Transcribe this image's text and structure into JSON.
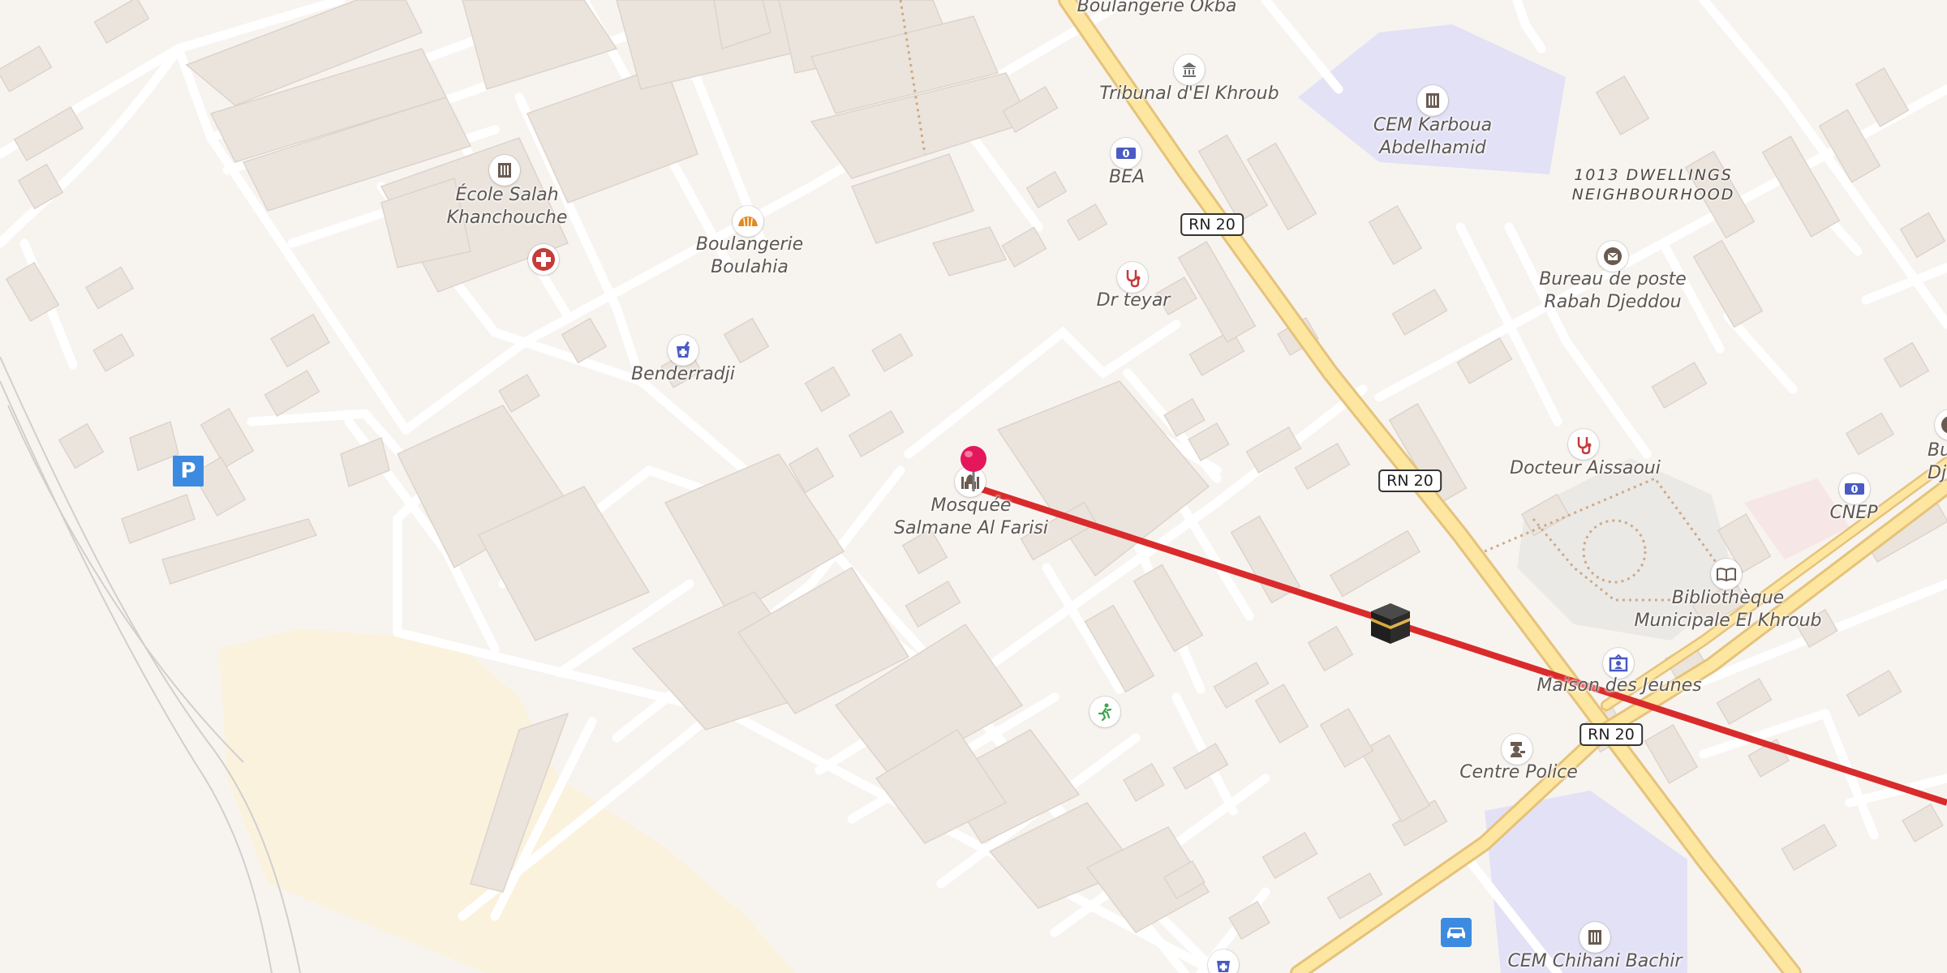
{
  "map": {
    "roads": [
      "RN 20",
      "RN 20",
      "RN 20"
    ],
    "area_label": "1013 DWELLINGS\nNEIGHBOURHOOD",
    "pois": [
      {
        "name": "Boulangerie Okba",
        "icon": "bakery-icon"
      },
      {
        "name": "Tribunal d'El Khroub",
        "icon": "courthouse-icon"
      },
      {
        "name": "CEM Karboua\nAbdelhamid",
        "icon": "school-icon"
      },
      {
        "name": "BEA",
        "icon": "bank-icon"
      },
      {
        "name": "Bureau de poste\nRabah Djeddou",
        "icon": "post-office-icon"
      },
      {
        "name": "École Salah\nKhanchouche",
        "icon": "school-icon"
      },
      {
        "name": "Boulangerie\nBoulahia",
        "icon": "bakery-icon"
      },
      {
        "name": "Dr teyar",
        "icon": "doctor-icon"
      },
      {
        "name": "Benderradji",
        "icon": "pharmacy-icon"
      },
      {
        "name": "Mosquée\nSalmane Al Farisi",
        "icon": "mosque-icon"
      },
      {
        "name": "Docteur Aissaoui",
        "icon": "doctor-icon"
      },
      {
        "name": "CNEP",
        "icon": "bank-icon"
      },
      {
        "name": "Bureau\nDjefe",
        "icon": "post-office-icon"
      },
      {
        "name": "Bibliothèque\nMunicipale El Khroub",
        "icon": "library-icon"
      },
      {
        "name": "Maison des Jeunes",
        "icon": "youth-center-icon"
      },
      {
        "name": "Centre Police",
        "icon": "police-icon"
      },
      {
        "name": "CEM Chihani Bachir",
        "icon": "school-icon"
      }
    ],
    "other_icons": [
      "hospital-cross-icon",
      "parking-icon",
      "sports-icon",
      "car-icon",
      "pharmacy-icon",
      "location-pin-icon",
      "kaaba-icon"
    ],
    "parking_label": "P",
    "qibla_line_color": "#d92b2b",
    "pin_color": "#e5175c"
  }
}
